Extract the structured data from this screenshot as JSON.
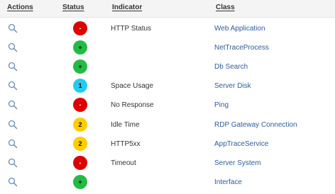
{
  "header": {
    "actions": "Actions",
    "status": "Status",
    "indicator": "Indicator",
    "class": "Class"
  },
  "colors": {
    "critical": "#dd0000",
    "ok": "#22bb44",
    "info": "#22ccee",
    "warning": "#ffcc00",
    "link": "#2e5c9a"
  },
  "rows": [
    {
      "action_icon": "search-icon",
      "status": "critical",
      "status_text": "-",
      "indicator": "HTTP Status",
      "class": "Web Application"
    },
    {
      "action_icon": "search-icon",
      "status": "ok",
      "status_text": "+",
      "indicator": "",
      "class": "NetTraceProcess"
    },
    {
      "action_icon": "search-icon",
      "status": "ok",
      "status_text": "+",
      "indicator": "",
      "class": "Db Search"
    },
    {
      "action_icon": "search-icon",
      "status": "info",
      "status_text": "1",
      "indicator": "Space Usage",
      "class": "Server Disk"
    },
    {
      "action_icon": "search-icon",
      "status": "critical",
      "status_text": "-",
      "indicator": "No Response",
      "class": "Ping"
    },
    {
      "action_icon": "search-icon",
      "status": "warning",
      "status_text": "2",
      "indicator": "Idle Time",
      "class": "RDP Gateway Connection"
    },
    {
      "action_icon": "search-icon",
      "status": "warning",
      "status_text": "2",
      "indicator": "HTTP5xx",
      "class": "AppTraceService"
    },
    {
      "action_icon": "search-icon",
      "status": "critical",
      "status_text": "-",
      "indicator": "Timeout",
      "class": "Server System"
    },
    {
      "action_icon": "search-icon",
      "status": "ok",
      "status_text": "+",
      "indicator": "",
      "class": "Interface"
    }
  ]
}
